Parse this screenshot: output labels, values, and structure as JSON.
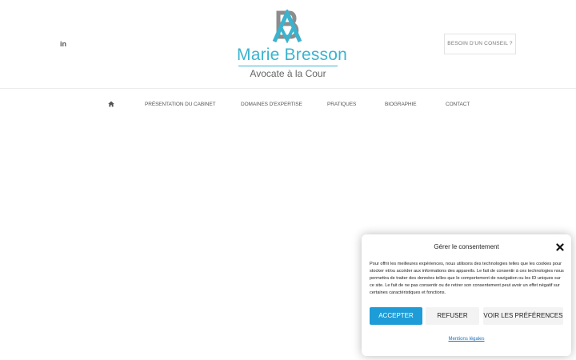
{
  "header": {
    "social_label": "in",
    "logo": {
      "name": "Marie Bresson",
      "subtitle": "Avocate à la Cour"
    },
    "cta_label": "BESOIN D'UN CONSEIL ?"
  },
  "nav": {
    "home_icon": "home-icon",
    "items": [
      {
        "label": "PRÉSENTATION DU CABINET"
      },
      {
        "label": "DOMAINES D'EXPERTISE"
      },
      {
        "label": "PRATIQUES"
      },
      {
        "label": "BIOGRAPHIE"
      },
      {
        "label": "CONTACT"
      }
    ]
  },
  "consent": {
    "title": "Gérer le consentement",
    "text": "Pour offrir les meilleures expériences, nous utilisons des technologies telles que les cookies pour stocker et/ou accéder aux informations des appareils. Le fait de consentir à ces technologies nous permettra de traiter des données telles que le comportement de navigation ou les ID uniques sur ce site. Le fait de ne pas consentir ou de retirer son consentement peut avoir un effet négatif sur certaines caractéristiques et fonctions.",
    "accept_label": "ACCEPTER",
    "refuse_label": "REFUSER",
    "prefs_label": "VOIR LES PRÉFÉRENCES",
    "legal_link": "Mentions légales"
  },
  "colors": {
    "brand": "#3bb3ce",
    "logo_gray": "#8c8c8c",
    "accept_bg": "#1e9cd7",
    "link": "#1e73be"
  }
}
